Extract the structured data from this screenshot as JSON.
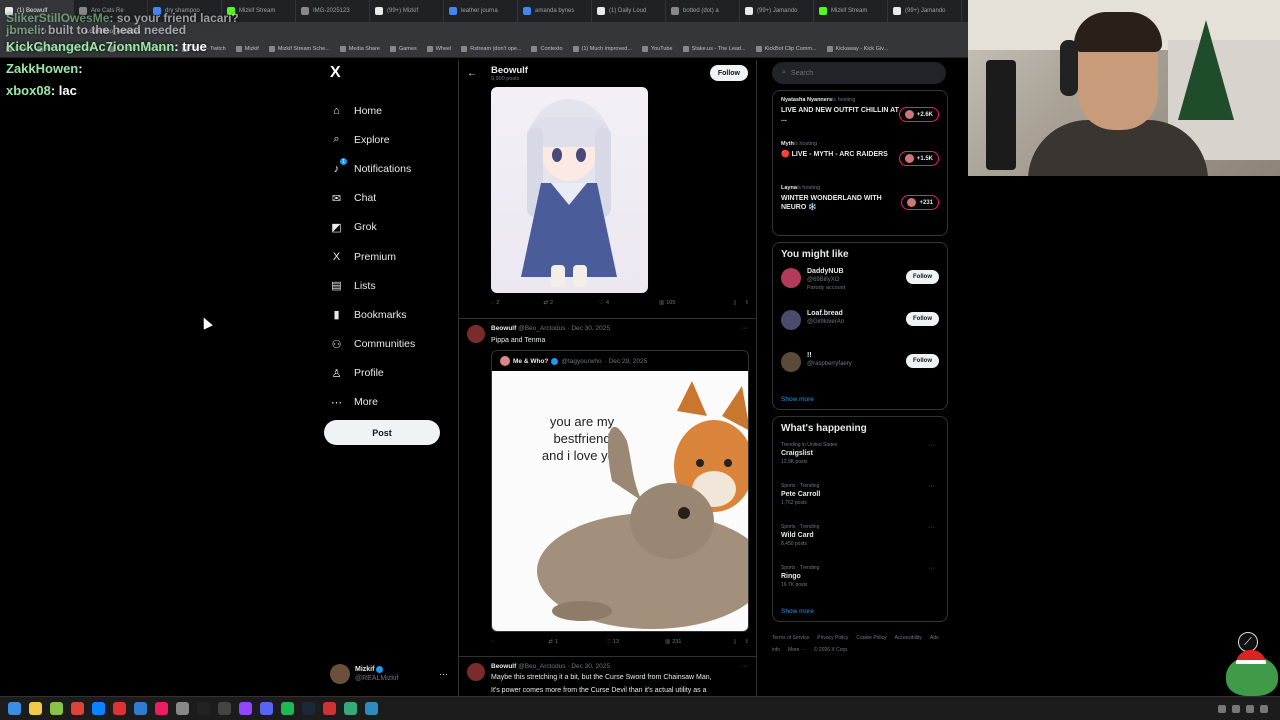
{
  "browser": {
    "tabs": [
      {
        "label": "(1) Beowulf",
        "active": true,
        "color": "#e7e9ea"
      },
      {
        "label": "Are Cats Re",
        "active": false,
        "color": "#888888"
      },
      {
        "label": "dry shampoo",
        "active": false,
        "color": "#4285f4"
      },
      {
        "label": "Mizkif Stream",
        "active": false,
        "color": "#53fc18"
      },
      {
        "label": "IMG-2025123",
        "active": false,
        "color": "#888888"
      },
      {
        "label": "(99+) Mizkif",
        "active": false,
        "color": "#e7e9ea"
      },
      {
        "label": "leather journa",
        "active": false,
        "color": "#4285f4"
      },
      {
        "label": "amanda bynes",
        "active": false,
        "color": "#4285f4"
      },
      {
        "label": "(1) Daily Loud",
        "active": false,
        "color": "#e7e9ea"
      },
      {
        "label": "botted (dot) a",
        "active": false,
        "color": "#888888"
      },
      {
        "label": "(99+) Jamando",
        "active": false,
        "color": "#e7e9ea"
      },
      {
        "label": "Mizkif Stream",
        "active": false,
        "color": "#53fc18"
      },
      {
        "label": "(99+) Jamando",
        "active": false,
        "color": "#e7e9ea"
      }
    ],
    "url": "x.com/Beo_Arctodus",
    "bookmarks": [
      "Clips",
      "Mizkif Stream - Wat...",
      "KickBot - Kick Chatb...",
      "Mizkif - Twitch",
      "Mizkif",
      "Mizkif Stream Sche...",
      "Media Share",
      "Games",
      "Wheel",
      "Rstream (don't ope...",
      "Contexto",
      "(1) Much improved...",
      "YouTube",
      "Stake.us - The Lead...",
      "KickBot Clip Comm...",
      "Kickaway - Kick Giv..."
    ]
  },
  "chat": [
    {
      "user": "SlikerStillOwesMe",
      "msg": ": so your friend lacari?",
      "faded": true
    },
    {
      "user": "jbmeli",
      "msg": ": built to the head needed",
      "faded": true
    },
    {
      "user": "KickChangedAc7ionnMann",
      "msg": ": true",
      "faded": false
    },
    {
      "user": "ZakkHowen",
      "msg": ":",
      "faded": false
    },
    {
      "user": "xbox08",
      "msg": ": lac",
      "faded": false
    }
  ],
  "sidebar": {
    "logo": "X",
    "items": [
      {
        "label": "Home",
        "icon": "home-icon",
        "glyph": "⌂"
      },
      {
        "label": "Explore",
        "icon": "search-icon",
        "glyph": "⌕"
      },
      {
        "label": "Notifications",
        "icon": "bell-icon",
        "glyph": "♪",
        "badge": "1"
      },
      {
        "label": "Chat",
        "icon": "mail-icon",
        "glyph": "✉"
      },
      {
        "label": "Grok",
        "icon": "grok-icon",
        "glyph": "◩"
      },
      {
        "label": "Premium",
        "icon": "x-logo-icon",
        "glyph": "X"
      },
      {
        "label": "Lists",
        "icon": "list-icon",
        "glyph": "▤"
      },
      {
        "label": "Bookmarks",
        "icon": "bookmark-icon",
        "glyph": "▮"
      },
      {
        "label": "Communities",
        "icon": "people-icon",
        "glyph": "⚇"
      },
      {
        "label": "Profile",
        "icon": "person-icon",
        "glyph": "♙"
      },
      {
        "label": "More",
        "icon": "more-circle-icon",
        "glyph": "⋯"
      }
    ],
    "post_label": "Post",
    "account": {
      "name": "Mizkif",
      "handle": "@REALMizkif"
    }
  },
  "timeline": {
    "header_name": "Beowulf",
    "header_sub": "9,900 posts",
    "follow_label": "Follow",
    "post1_actions": {
      "replies": "2",
      "reposts": "2",
      "likes": "4",
      "views": "105"
    },
    "post2": {
      "name": "Beowulf",
      "handle": "@Beo_Arctodus",
      "date": "· Dec 30, 2025",
      "text": "Pippa and Tenma",
      "quote": {
        "name": "Me & Who?",
        "handle": "@tagyourwho",
        "date": "· Dec 29, 2025",
        "image_text": [
          "you are my",
          "bestfriend",
          "and i love you"
        ]
      },
      "actions": {
        "replies": "",
        "reposts": "1",
        "likes": "13",
        "views": "231"
      }
    },
    "post3": {
      "name": "Beowulf",
      "handle": "@Beo_Arctodus",
      "date": "· Dec 30, 2025",
      "text": "Maybe this stretching it a bit, but the Curse Sword from Chainsaw Man,",
      "text2": "It's power comes more from the Curse Devil than it's actual utility as a"
    }
  },
  "right": {
    "search_placeholder": "Search",
    "live": [
      {
        "host": "Nyatasha Nyanners",
        "status": "is hosting",
        "title": "LIVE AND NEW OUTFIT CHILLIN AT ...",
        "count": "+2.6K"
      },
      {
        "host": "Myth",
        "status": "is hosting",
        "title": "🔴 LIVE - MYTH - ARC RAIDERS",
        "count": "+1.5K"
      },
      {
        "host": "Layna",
        "status": "is hosting",
        "title": "WINTER WONDERLAND WITH NEURO ❄️",
        "count": "+231"
      }
    ],
    "wtf_title": "You might like",
    "wtf": [
      {
        "name": "DaddyNUB",
        "handle": "@69BillyXO",
        "badge": "Parody account",
        "follow": "Follow"
      },
      {
        "name": "Loaf.bread",
        "handle": "@GirllloverAn",
        "badge": "",
        "follow": "Follow"
      },
      {
        "name": "!!",
        "handle": "@raspberryfaery",
        "badge": "",
        "follow": "Follow"
      }
    ],
    "show_more": "Show more",
    "trends_title": "What's happening",
    "trends": [
      {
        "category": "Trending in United States",
        "name": "Craigslist",
        "count": "12.9K posts"
      },
      {
        "category": "Sports · Trending",
        "name": "Pete Carroll",
        "count": "1,762 posts"
      },
      {
        "category": "Sports · Trending",
        "name": "Wild Card",
        "count": "8,450 posts"
      },
      {
        "category": "Sports · Trending",
        "name": "Ringo",
        "count": "16.7K posts"
      }
    ],
    "footer": [
      "Terms of Service",
      "Privacy Policy",
      "Cookie Policy",
      "Accessibility",
      "Ads info",
      "More ···",
      "© 2026 X Corp."
    ]
  },
  "taskbar_icons": [
    "windows-icon",
    "explorer-icon",
    "app-icon",
    "chrome-icon",
    "edge-icon",
    "app-icon",
    "app-icon",
    "app-icon",
    "app-icon",
    "app-icon",
    "app-icon",
    "app-icon",
    "discord-icon",
    "app-icon",
    "steam-icon",
    "app-icon",
    "app-icon",
    "app-icon"
  ]
}
